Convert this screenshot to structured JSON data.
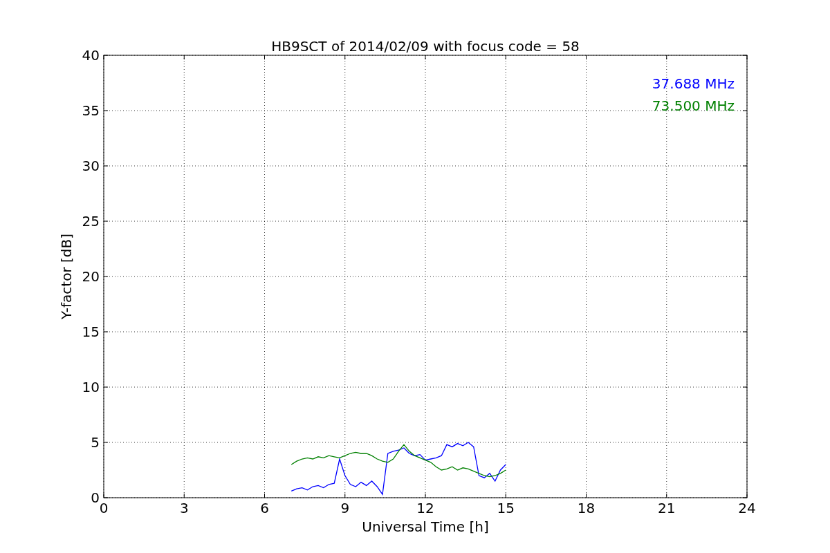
{
  "chart_data": {
    "type": "line",
    "title": "HB9SCT of 2014/02/09 with focus code = 58",
    "xlabel": "Universal Time [h]",
    "ylabel": "Y-factor [dB]",
    "x": [
      7.0,
      7.2,
      7.4,
      7.6,
      7.8,
      8.0,
      8.2,
      8.4,
      8.6,
      8.8,
      9.0,
      9.2,
      9.4,
      9.6,
      9.8,
      10.0,
      10.2,
      10.4,
      10.6,
      10.8,
      11.0,
      11.2,
      11.4,
      11.6,
      11.8,
      12.0,
      12.2,
      12.4,
      12.6,
      12.8,
      13.0,
      13.2,
      13.4,
      13.6,
      13.8,
      14.0,
      14.2,
      14.4,
      14.6,
      14.8,
      15.0
    ],
    "series": [
      {
        "name": "37.688 MHz",
        "color": "#0000ff",
        "values": [
          0.6,
          0.8,
          0.9,
          0.7,
          1.0,
          1.1,
          0.9,
          1.2,
          1.3,
          3.5,
          2.0,
          1.2,
          1.0,
          1.4,
          1.1,
          1.5,
          1.0,
          0.3,
          4.0,
          4.2,
          4.3,
          4.5,
          4.0,
          3.8,
          3.9,
          3.4,
          3.5,
          3.6,
          3.8,
          4.8,
          4.6,
          4.9,
          4.7,
          5.0,
          4.6,
          2.0,
          1.8,
          2.2,
          1.5,
          2.5,
          3.0
        ]
      },
      {
        "name": "73.500 MHz",
        "color": "#008000",
        "values": [
          3.0,
          3.3,
          3.5,
          3.6,
          3.5,
          3.7,
          3.6,
          3.8,
          3.7,
          3.6,
          3.8,
          4.0,
          4.1,
          4.0,
          4.0,
          3.8,
          3.5,
          3.3,
          3.2,
          3.5,
          4.2,
          4.8,
          4.2,
          3.8,
          3.6,
          3.4,
          3.2,
          2.8,
          2.5,
          2.6,
          2.8,
          2.5,
          2.7,
          2.6,
          2.4,
          2.2,
          2.0,
          1.9,
          2.0,
          2.2,
          2.5
        ]
      }
    ],
    "grid": true,
    "xlim": [
      0,
      24
    ],
    "ylim": [
      0,
      40
    ],
    "xticks": [
      0,
      3,
      6,
      9,
      12,
      15,
      18,
      21,
      24
    ],
    "yticks": [
      0,
      5,
      10,
      15,
      20,
      25,
      30,
      35,
      40
    ]
  }
}
